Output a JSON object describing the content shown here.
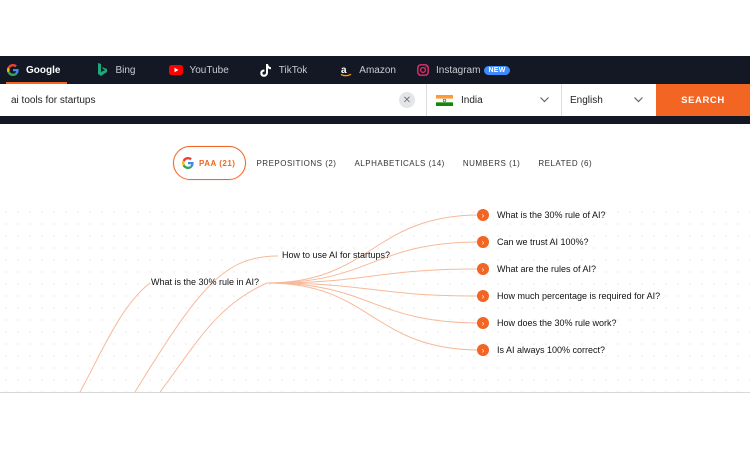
{
  "engines": [
    {
      "label": "Google",
      "icon": "google-icon",
      "active": true
    },
    {
      "label": "Bing",
      "icon": "bing-icon"
    },
    {
      "label": "YouTube",
      "icon": "youtube-icon"
    },
    {
      "label": "TikTok",
      "icon": "tiktok-icon"
    },
    {
      "label": "Amazon",
      "icon": "amazon-icon"
    },
    {
      "label": "Instagram",
      "icon": "instagram-icon",
      "badge": "NEW"
    }
  ],
  "search": {
    "query": "ai tools for startups",
    "clear_glyph": "✕",
    "country": "India",
    "language": "English",
    "button_label": "SEARCH"
  },
  "tabs": [
    {
      "label": "PAA (21)",
      "active": true
    },
    {
      "label": "PREPOSITIONS (2)"
    },
    {
      "label": "ALPHABETICALS (14)"
    },
    {
      "label": "NUMBERS (1)"
    },
    {
      "label": "RELATED (6)"
    }
  ],
  "tree": {
    "root": "What is the 30% rule in AI?",
    "branch": "How to use AI for startups?",
    "leaves": [
      "What is the 30% rule of AI?",
      "Can we trust AI 100%?",
      "What are the rules of AI?",
      "How much percentage is required for AI?",
      "How does the 30% rule work?",
      "Is AI always 100% correct?"
    ]
  },
  "colors": {
    "accent": "#f26522",
    "topbar": "#141824",
    "badge": "#3d8bfd"
  }
}
